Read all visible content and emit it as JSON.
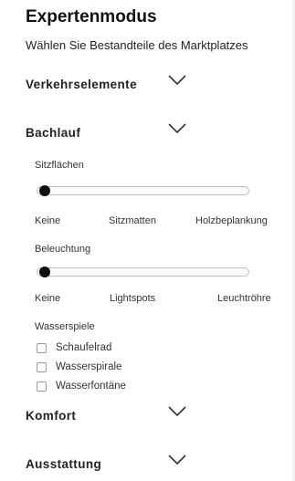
{
  "header": {
    "title": "Expertenmodus",
    "subtitle": "Wählen Sie Bestandteile des Marktplatzes"
  },
  "sections": {
    "verkehr": {
      "label": "Verkehrselemente",
      "icon": "chevron-down-icon"
    },
    "bachlauf": {
      "label": "Bachlauf",
      "icon": "chevron-down-icon"
    },
    "komfort": {
      "label": "Komfort",
      "icon": "chevron-down-icon"
    },
    "ausstattung": {
      "label": "Ausstattung",
      "icon": "chevron-down-icon"
    }
  },
  "bachlauf": {
    "sitzflaechen": {
      "label": "Sitzflächen",
      "options": [
        "Keine",
        "Sitzmatten",
        "Holzbeplankung"
      ],
      "selected": "Keine"
    },
    "beleuchtung": {
      "label": "Beleuchtung",
      "options": [
        "Keine",
        "Lightspots",
        "Leuchtröhre"
      ],
      "selected": "Keine"
    },
    "wasserspiele": {
      "label": "Wasserspiele",
      "items": [
        {
          "label": "Schaufelrad",
          "checked": false
        },
        {
          "label": "Wasserspirale",
          "checked": false
        },
        {
          "label": "Wasserfontäne",
          "checked": false
        }
      ]
    }
  }
}
